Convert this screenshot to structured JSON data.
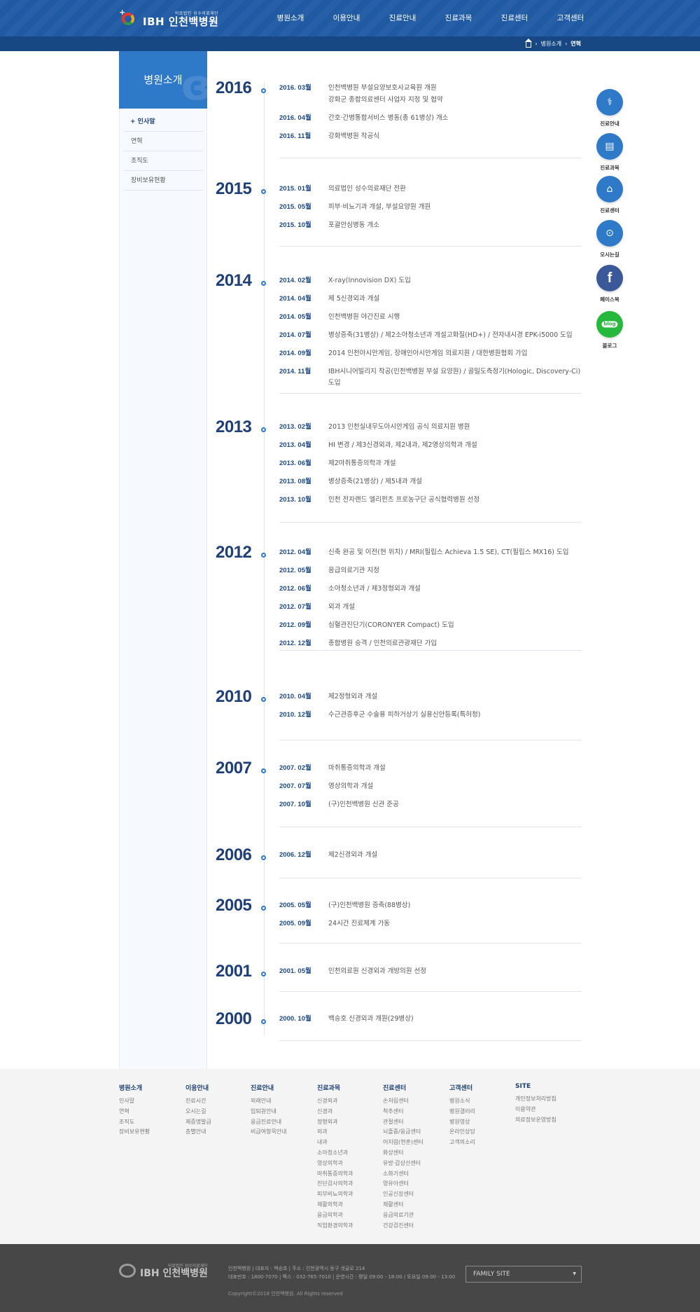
{
  "header": {
    "logo_sub": "의료법인 성수의료재단",
    "logo_main": "IBH 인천백병원",
    "nav": [
      "병원소개",
      "이용안내",
      "진료안내",
      "진료과목",
      "진료센터",
      "고객센터"
    ]
  },
  "breadcrumb": {
    "level1": "병원소개",
    "current": "연혁"
  },
  "sidebar": {
    "title": "병원소개",
    "items": [
      "+ 인사말",
      "연혁",
      "조직도",
      "장비보유현황"
    ]
  },
  "timeline": [
    {
      "year": "2016",
      "events": [
        {
          "date": "2016. 03월",
          "text": "인천백병원 부설요양보호사교육원 개원"
        },
        {
          "date": "",
          "text": "강화군 종합의료센터 사업자 지정 및 협약"
        },
        {
          "date": "2016. 04월",
          "text": "간호·간병통합서비스 병동(총 61병상) 개소"
        },
        {
          "date": "2016. 11월",
          "text": "강화백병원 착공식"
        }
      ]
    },
    {
      "year": "2015",
      "events": [
        {
          "date": "2015. 01월",
          "text": "의료법인 성수의료재단 전환"
        },
        {
          "date": "2015. 05월",
          "text": "피부·비뇨기과 개설, 부설요양원 개원"
        },
        {
          "date": "2015. 10월",
          "text": "포괄안심병동 개소"
        }
      ]
    },
    {
      "year": "2014",
      "events": [
        {
          "date": "2014. 02월",
          "text": "X-ray(Innovision DX) 도입"
        },
        {
          "date": "2014. 04월",
          "text": "제 5신경외과 개설"
        },
        {
          "date": "2014. 05월",
          "text": "인천백병원 야간진료 시행"
        },
        {
          "date": "2014. 07월",
          "text": "병상증축(31병상) / 제2소아청소년과 개설고화질(HD+) / 전자내시경 EPK-i5000 도입"
        },
        {
          "date": "2014. 09월",
          "text": "2014 인천아시안게임, 장애인아시안게임 의료지원 / 대한병원협회 가입"
        },
        {
          "date": "2014. 11월",
          "text": "IBH시니어빌리지 착공(인천백병원 부설 요양원) / 골밀도측정기(Hologic, Discovery-Ci) 도입"
        }
      ]
    },
    {
      "year": "2013",
      "events": [
        {
          "date": "2013. 02월",
          "text": "2013 인천실내무도아시안게임 공식 의료지원 병원"
        },
        {
          "date": "2013. 04월",
          "text": "HI 변경 / 제3신경외과, 제2내과, 제2영상의학과 개설"
        },
        {
          "date": "2013. 06월",
          "text": "제2마취통증의학과 개설"
        },
        {
          "date": "2013. 08월",
          "text": "병상증축(21병상) / 제5내과 개설"
        },
        {
          "date": "2013. 10월",
          "text": "인천 전자랜드 엘리펀츠 프로농구단 공식협력병원 선정"
        }
      ]
    },
    {
      "year": "2012",
      "events": [
        {
          "date": "2012. 04월",
          "text": "신축 완공 및 이전(현 위치) / MRI(필립스 Achieva 1.5 SE), CT(필립스 MX16) 도입"
        },
        {
          "date": "2012. 05월",
          "text": "응급의료기관 지정"
        },
        {
          "date": "2012. 06월",
          "text": "소아청소년과 / 제3정형외과 개설"
        },
        {
          "date": "2012. 07월",
          "text": "외과 개설"
        },
        {
          "date": "2012. 09월",
          "text": "심혈관진단기(CORONYER Compact) 도입"
        },
        {
          "date": "2012. 12월",
          "text": "종합병원 승격 / 인천의료관광재단 가입"
        }
      ]
    },
    {
      "year": "2010",
      "events": [
        {
          "date": "2010. 04월",
          "text": "제2정형외과 개설"
        },
        {
          "date": "2010. 12월",
          "text": "수근관증후군 수술용 피하거상기 실용신안등록(특허청)"
        }
      ]
    },
    {
      "year": "2007",
      "events": [
        {
          "date": "2007. 02월",
          "text": "마취통증의학과 개설"
        },
        {
          "date": "2007. 07월",
          "text": "영상의학과 개설"
        },
        {
          "date": "2007. 10월",
          "text": "(구)인천백병원 신관 준공"
        }
      ]
    },
    {
      "year": "2006",
      "events": [
        {
          "date": "2006. 12월",
          "text": "제2신경외과 개설"
        }
      ]
    },
    {
      "year": "2005",
      "events": [
        {
          "date": "2005. 05월",
          "text": "(구)인천백병원 증축(88병상)"
        },
        {
          "date": "2005. 09월",
          "text": "24시간 진료체계 가동"
        }
      ]
    },
    {
      "year": "2001",
      "events": [
        {
          "date": "2001. 05월",
          "text": "인천의료원 신경외과 개방의원 선정"
        }
      ]
    },
    {
      "year": "2000",
      "events": [
        {
          "date": "2000. 10월",
          "text": "백승호 신경외과 개원(29병상)"
        }
      ]
    }
  ],
  "quick_menu": [
    {
      "label": "진료안내",
      "icon": "stethoscope-icon",
      "color": "#2f79c9"
    },
    {
      "label": "진료과목",
      "icon": "clipboard-icon",
      "color": "#2f79c9"
    },
    {
      "label": "진료센터",
      "icon": "hospital-icon",
      "color": "#2f79c9"
    },
    {
      "label": "오시는길",
      "icon": "location-pin-icon",
      "color": "#2f79c9"
    },
    {
      "label": "페이스북",
      "icon": "facebook-icon",
      "color": "#3b5998"
    },
    {
      "label": "블로그",
      "icon": "blog-icon",
      "color": "#25b83d"
    }
  ],
  "footer_sitemap": [
    {
      "title": "병원소개",
      "items": [
        "인사말",
        "연혁",
        "조직도",
        "장비보유현황"
      ]
    },
    {
      "title": "이용안내",
      "items": [
        "진료시간",
        "오시는길",
        "제증명발급",
        "층별안내"
      ]
    },
    {
      "title": "진료안내",
      "items": [
        "외래안내",
        "입퇴원안내",
        "응급진료안내",
        "비급여항목안내"
      ]
    },
    {
      "title": "진료과목",
      "items": [
        "신경외과",
        "신경과",
        "정형외과",
        "외과",
        "내과",
        "소아청소년과",
        "영상의학과",
        "마취통증의학과",
        "진단검사의학과",
        "피부비뇨의학과",
        "재활의학과",
        "응급의학과",
        "직업환경의학과"
      ]
    },
    {
      "title": "진료센터",
      "items": [
        "손저림센터",
        "척추센터",
        "관절센터",
        "뇌졸중/응급센터",
        "어지럼(현훈)센터",
        "화상센터",
        "유방·갑상선센터",
        "소화기센터",
        "영유아센터",
        "인공신장센터",
        "재활센터",
        "응급의료기관",
        "건강검진센터"
      ]
    },
    {
      "title": "고객센터",
      "items": [
        "병원소식",
        "병원갤러리",
        "병원영상",
        "온라인상담",
        "고객의소리"
      ]
    },
    {
      "title": "SITE",
      "items": [
        "개인정보처리방침",
        "이용약관",
        "의료정보운영방침"
      ]
    }
  ],
  "footer": {
    "logo_sub": "의료법인 성수의료재단",
    "logo_main": "IBH 인천백병원",
    "info_line1": "인천백병원 | 대표자 : 백승호 | 주소 : 인천광역시 동구 샛골로 214",
    "info_line2": "대표번호 : 1800-7070 | 팩스 : 032-765-7010 | 운영시간 : 평일 09:00 - 18:00 / 토요일 09:00 - 13:00",
    "copyright": "Copyright©2018 인천백병원. All Rights reserved",
    "family_site": "FAMILY SITE"
  },
  "colors": {
    "header_blue": "#1f5aa3",
    "subbar_blue": "#174884",
    "accent_blue": "#2f79c9",
    "year_navy": "#1e3f77"
  }
}
